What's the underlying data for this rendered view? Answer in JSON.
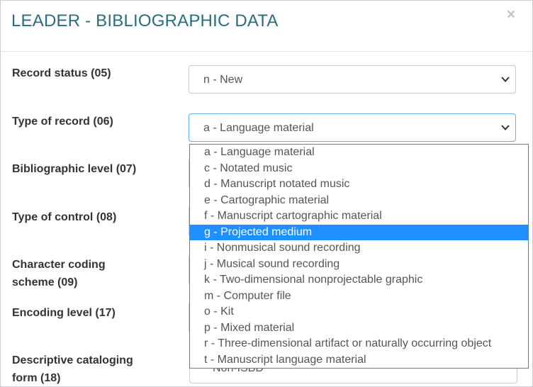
{
  "dialog": {
    "title": "LEADER - BIBLIOGRAPHIC DATA",
    "close_label": "×"
  },
  "fields": {
    "record_status": {
      "label": "Record status (05)",
      "value": "n - New"
    },
    "type_of_record": {
      "label": "Type of record (06)",
      "value": "a - Language material"
    },
    "bibliographic_level": {
      "label": "Bibliographic level (07)"
    },
    "type_of_control": {
      "label": "Type of control (08)"
    },
    "character_coding_scheme": {
      "label_line1": "Character coding",
      "label_line2": "scheme (09)"
    },
    "encoding_level": {
      "label": "Encoding level (17)"
    },
    "descriptive_cataloging_form": {
      "label_line1": "Descriptive cataloging",
      "label_line2": "form (18)",
      "partial_value": "Non-ISBD"
    }
  },
  "type_of_record_options": [
    "a - Language material",
    "c - Notated music",
    "d - Manuscript notated music",
    "e - Cartographic material",
    "f - Manuscript cartographic material",
    "g - Projected medium",
    "i - Nonmusical sound recording",
    "j - Musical sound recording",
    "k - Two-dimensional nonprojectable graphic",
    "m - Computer file",
    "o - Kit",
    "p - Mixed material",
    "r - Three-dimensional artifact or naturally occurring object",
    "t - Manuscript language material"
  ],
  "highlighted_option": "g - Projected medium",
  "colors": {
    "title": "#2a6d7c",
    "highlight": "#1e90ff",
    "focus_border": "#66afe9"
  },
  "icons": {
    "dropdown": "chevron-down-icon",
    "close": "close-icon"
  }
}
